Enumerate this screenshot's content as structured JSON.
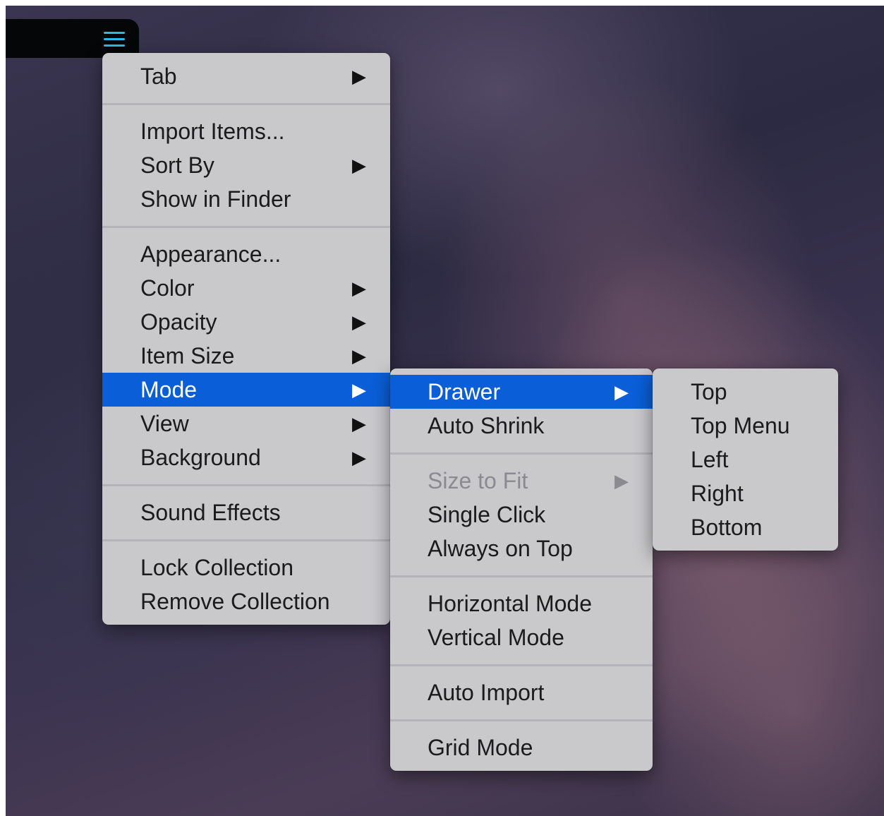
{
  "toolbar": {
    "menu_icon": "hamburger-menu-icon",
    "accent_color": "#2fb6e8"
  },
  "main_menu": {
    "items": [
      {
        "label": "Tab",
        "has_submenu": true
      },
      {
        "label": "Import Items...",
        "has_submenu": false
      },
      {
        "label": "Sort By",
        "has_submenu": true
      },
      {
        "label": "Show in Finder",
        "has_submenu": false
      },
      {
        "label": "Appearance...",
        "has_submenu": false
      },
      {
        "label": "Color",
        "has_submenu": true
      },
      {
        "label": "Opacity",
        "has_submenu": true
      },
      {
        "label": "Item Size",
        "has_submenu": true
      },
      {
        "label": "Mode",
        "has_submenu": true,
        "selected": true
      },
      {
        "label": "View",
        "has_submenu": true
      },
      {
        "label": "Background",
        "has_submenu": true
      },
      {
        "label": "Sound Effects",
        "has_submenu": false
      },
      {
        "label": "Lock Collection",
        "has_submenu": false
      },
      {
        "label": "Remove Collection",
        "has_submenu": false
      }
    ]
  },
  "mode_menu": {
    "items": [
      {
        "label": "Drawer",
        "has_submenu": true,
        "selected": true
      },
      {
        "label": "Auto Shrink",
        "has_submenu": false
      },
      {
        "label": "Size to Fit",
        "has_submenu": true,
        "disabled": true
      },
      {
        "label": "Single Click",
        "has_submenu": false
      },
      {
        "label": "Always on Top",
        "has_submenu": false
      },
      {
        "label": "Horizontal Mode",
        "has_submenu": false
      },
      {
        "label": "Vertical Mode",
        "has_submenu": false
      },
      {
        "label": "Auto Import",
        "has_submenu": false
      },
      {
        "label": "Grid Mode",
        "has_submenu": false
      }
    ]
  },
  "drawer_menu": {
    "items": [
      {
        "label": "Top"
      },
      {
        "label": "Top Menu"
      },
      {
        "label": "Left"
      },
      {
        "label": "Right"
      },
      {
        "label": "Bottom"
      }
    ]
  },
  "submenu_arrow": "▶",
  "colors": {
    "menu_background": "#c9c9cc",
    "selection": "#0a5ed7",
    "separator": "#b3b3b8",
    "disabled_text": "#8a8a90"
  }
}
